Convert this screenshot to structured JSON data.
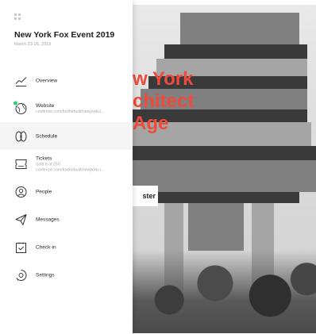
{
  "event": {
    "title": "New York Fox Event 2019",
    "date": "March 23-26, 2019"
  },
  "hero": {
    "title_lines": [
      "w York",
      "chitect",
      "Age"
    ],
    "button_label": "ster",
    "accent_color": "#ef4b3c"
  },
  "nav": {
    "items": [
      {
        "label": "Overview",
        "icon": "chart-line-icon"
      },
      {
        "label": "Website",
        "sub": "conferize.com/foxthebuilt/newyorkci...",
        "icon": "globe-icon",
        "badge": true
      },
      {
        "label": "Schedule",
        "icon": "schedule-icon",
        "active": true
      },
      {
        "label": "Tickets",
        "sub": "Sold 6 of 250",
        "sub2": "conferize.com/foxthebuilt/newyorkci...",
        "icon": "ticket-icon"
      },
      {
        "label": "People",
        "icon": "person-icon"
      },
      {
        "label": "Messages",
        "icon": "paper-plane-icon"
      },
      {
        "label": "Check-in",
        "icon": "check-in-icon"
      },
      {
        "label": "Settings",
        "icon": "settings-icon"
      }
    ]
  }
}
